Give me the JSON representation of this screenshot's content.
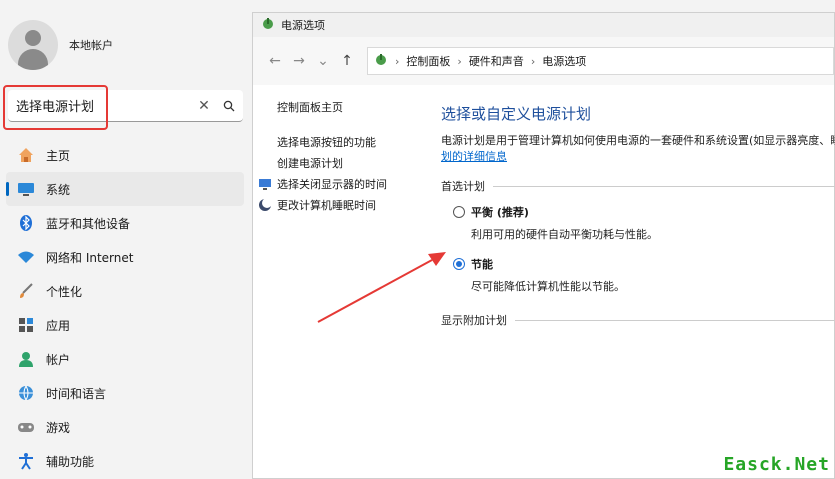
{
  "settings": {
    "account_name": "本地帐户",
    "search_value": "选择电源计划",
    "nav": [
      {
        "label": "主页",
        "icon": "home-icon"
      },
      {
        "label": "系统",
        "icon": "monitor-icon"
      },
      {
        "label": "蓝牙和其他设备",
        "icon": "bluetooth-icon"
      },
      {
        "label": "网络和 Internet",
        "icon": "wifi-icon"
      },
      {
        "label": "个性化",
        "icon": "brush-icon"
      },
      {
        "label": "应用",
        "icon": "apps-icon"
      },
      {
        "label": "帐户",
        "icon": "person-icon"
      },
      {
        "label": "时间和语言",
        "icon": "globe-icon"
      },
      {
        "label": "游戏",
        "icon": "gamepad-icon"
      },
      {
        "label": "辅助功能",
        "icon": "accessibility-icon"
      }
    ],
    "active_index": 1
  },
  "window": {
    "title": "电源选项",
    "breadcrumb": [
      "控制面板",
      "硬件和声音",
      "电源选项"
    ],
    "left_home": "控制面板主页",
    "left_links": [
      "选择电源按钮的功能",
      "创建电源计划",
      "选择关闭显示器的时间",
      "更改计算机睡眠时间"
    ],
    "heading": "选择或自定义电源计划",
    "description": "电源计划是用于管理计算机如何使用电源的一套硬件和系统设置(如显示器亮度、睡眠等)",
    "description_link": "划的详细信息",
    "section_preferred": "首选计划",
    "plans": [
      {
        "name": "平衡 (推荐)",
        "desc": "利用可用的硬件自动平衡功耗与性能。",
        "checked": false
      },
      {
        "name": "节能",
        "desc": "尽可能降低计算机性能以节能。",
        "checked": true
      }
    ],
    "section_extra": "显示附加计划"
  },
  "watermark": "Easck.Net",
  "colors": {
    "highlight": "#e53935",
    "accent": "#0067c0",
    "link": "#0066cc",
    "watermark": "#26a526"
  }
}
